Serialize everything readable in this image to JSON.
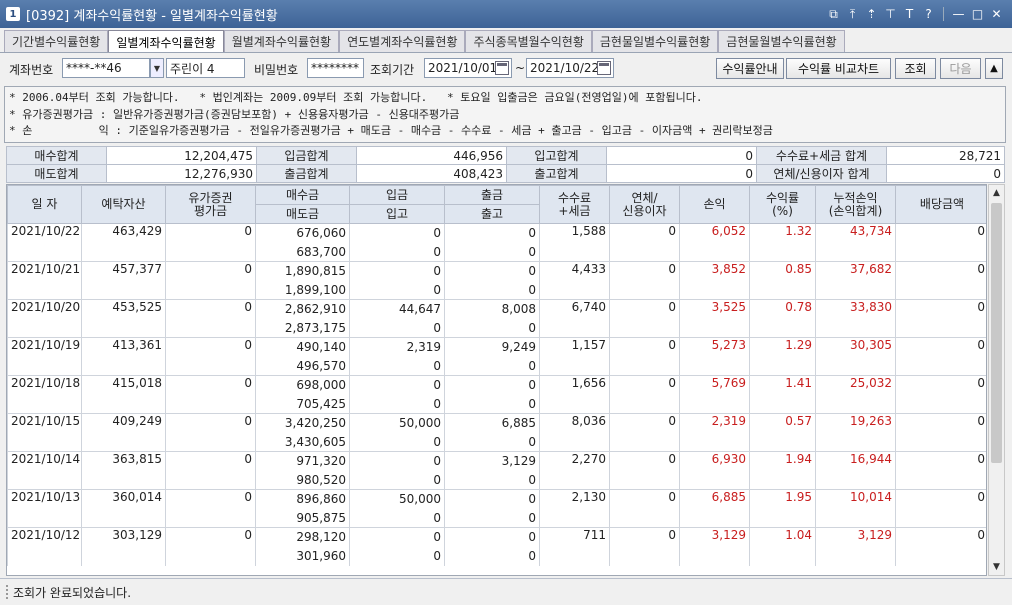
{
  "window": {
    "number": "1",
    "title": "[0392] 계좌수익률현황 - 일별계좌수익률현황",
    "controls": [
      "link-icon",
      "pin-icon",
      "upload-icon",
      "thumbtack-icon",
      "T",
      "?",
      "minimize-icon",
      "maximize-icon",
      "close-icon"
    ]
  },
  "tabs": [
    {
      "label": "기간별수익률현황",
      "active": false
    },
    {
      "label": "일별계좌수익률현황",
      "active": true
    },
    {
      "label": "월별계좌수익률현황",
      "active": false
    },
    {
      "label": "연도별계좌수익률현황",
      "active": false
    },
    {
      "label": "주식종목별월수익현황",
      "active": false
    },
    {
      "label": "금현물일별수익률현황",
      "active": false
    },
    {
      "label": "금현물월별수익률현황",
      "active": false
    }
  ],
  "search": {
    "account_label": "계좌번호",
    "account_value": "****-**46",
    "account_name": "주린이 4",
    "password_label": "비밀번호",
    "password_value": "********",
    "period_label": "조회기간",
    "date_from": "2021/10/01",
    "date_sep": "~",
    "date_to": "2021/10/22",
    "btn_guide": "수익률안내",
    "btn_compare": "수익률 비교차트",
    "btn_query": "조회",
    "btn_next": "다음",
    "btn_up": "▲"
  },
  "notice": {
    "line1": "* 2006.04부터 조회 가능합니다.   * 법인계좌는 2009.09부터 조회 가능합니다.   * 토요일 입출금은 금요일(전영업일)에 포함됩니다.",
    "line2": "* 유가증권평가금 : 일반유가증권평가금(증권담보포함) + 신용융자평가금 - 신용대주평가금",
    "line3": "* 손          익 : 기준일유가증권평가금 - 전일유가증권평가금 + 매도금 - 매수금 - 수수료 - 세금 + 출고금 - 입고금 - 이자금액 + 권리락보정금"
  },
  "summary": {
    "buy_total_label": "매수합계",
    "buy_total": "12,204,475",
    "deposit_total_label": "입금합계",
    "deposit_total": "446,956",
    "stock_in_total_label": "입고합계",
    "stock_in_total": "0",
    "fee_tax_total_label": "수수료+세금 합계",
    "fee_tax_total": "28,721",
    "sell_total_label": "매도합계",
    "sell_total": "12,276,930",
    "withdraw_total_label": "출금합계",
    "withdraw_total": "408,423",
    "stock_out_total_label": "출고합계",
    "stock_out_total": "0",
    "interest_total_label": "연체/신용이자 합계",
    "interest_total": "0"
  },
  "grid": {
    "headers": {
      "date": "일 자",
      "deposit_asset": "예탁자산",
      "securities_eval": "유가증권\n평가금",
      "buy": "매수금",
      "sell": "매도금",
      "deposit": "입금",
      "stock_in": "입고",
      "withdraw": "출금",
      "stock_out": "출고",
      "fee_tax": "수수료\n+세금",
      "interest": "연체/\n신용이자",
      "pnl": "손익",
      "return_rate": "수익률\n(%)",
      "cum_pnl": "누적손익\n(손익합계)",
      "dividend": "배당금액"
    },
    "rows": [
      {
        "date": "2021/10/22",
        "asset": "463,429",
        "sec": "0",
        "buy": "676,060",
        "sell": "683,700",
        "dep": "0",
        "sin": "0",
        "wd": "0",
        "sout": "0",
        "fee": "1,588",
        "int": "0",
        "pnl": "6,052",
        "rate": "1.32",
        "cum": "43,734",
        "div": "0"
      },
      {
        "date": "2021/10/21",
        "asset": "457,377",
        "sec": "0",
        "buy": "1,890,815",
        "sell": "1,899,100",
        "dep": "0",
        "sin": "0",
        "wd": "0",
        "sout": "0",
        "fee": "4,433",
        "int": "0",
        "pnl": "3,852",
        "rate": "0.85",
        "cum": "37,682",
        "div": "0"
      },
      {
        "date": "2021/10/20",
        "asset": "453,525",
        "sec": "0",
        "buy": "2,862,910",
        "sell": "2,873,175",
        "dep": "44,647",
        "sin": "0",
        "wd": "8,008",
        "sout": "0",
        "fee": "6,740",
        "int": "0",
        "pnl": "3,525",
        "rate": "0.78",
        "cum": "33,830",
        "div": "0"
      },
      {
        "date": "2021/10/19",
        "asset": "413,361",
        "sec": "0",
        "buy": "490,140",
        "sell": "496,570",
        "dep": "2,319",
        "sin": "0",
        "wd": "9,249",
        "sout": "0",
        "fee": "1,157",
        "int": "0",
        "pnl": "5,273",
        "rate": "1.29",
        "cum": "30,305",
        "div": "0"
      },
      {
        "date": "2021/10/18",
        "asset": "415,018",
        "sec": "0",
        "buy": "698,000",
        "sell": "705,425",
        "dep": "0",
        "sin": "0",
        "wd": "0",
        "sout": "0",
        "fee": "1,656",
        "int": "0",
        "pnl": "5,769",
        "rate": "1.41",
        "cum": "25,032",
        "div": "0"
      },
      {
        "date": "2021/10/15",
        "asset": "409,249",
        "sec": "0",
        "buy": "3,420,250",
        "sell": "3,430,605",
        "dep": "50,000",
        "sin": "0",
        "wd": "6,885",
        "sout": "0",
        "fee": "8,036",
        "int": "0",
        "pnl": "2,319",
        "rate": "0.57",
        "cum": "19,263",
        "div": "0"
      },
      {
        "date": "2021/10/14",
        "asset": "363,815",
        "sec": "0",
        "buy": "971,320",
        "sell": "980,520",
        "dep": "0",
        "sin": "0",
        "wd": "3,129",
        "sout": "0",
        "fee": "2,270",
        "int": "0",
        "pnl": "6,930",
        "rate": "1.94",
        "cum": "16,944",
        "div": "0"
      },
      {
        "date": "2021/10/13",
        "asset": "360,014",
        "sec": "0",
        "buy": "896,860",
        "sell": "905,875",
        "dep": "50,000",
        "sin": "0",
        "wd": "0",
        "sout": "0",
        "fee": "2,130",
        "int": "0",
        "pnl": "6,885",
        "rate": "1.95",
        "cum": "10,014",
        "div": "0"
      },
      {
        "date": "2021/10/12",
        "asset": "303,129",
        "sec": "0",
        "buy": "298,120",
        "sell": "301,960",
        "dep": "0",
        "sin": "0",
        "wd": "0",
        "sout": "0",
        "fee": "711",
        "int": "0",
        "pnl": "3,129",
        "rate": "1.04",
        "cum": "3,129",
        "div": "0"
      }
    ]
  },
  "status": {
    "message": "조회가 완료되었습니다."
  },
  "colors": {
    "profit": "#c81e1e",
    "header_bg": "#dfe6f0",
    "title_bar": "#3d6396"
  }
}
